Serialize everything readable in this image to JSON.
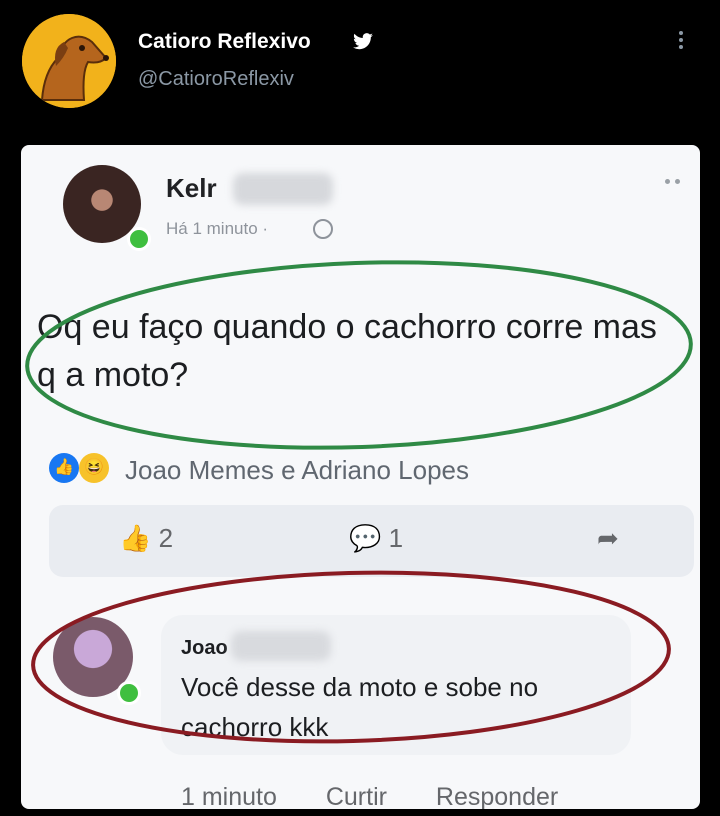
{
  "tweet": {
    "display_name": "Catioro Reflexivo",
    "handle": "@CatioroReflexiv",
    "verified_icon": "twitter-bird-icon",
    "more_icon": "vertical-dots-icon"
  },
  "post": {
    "author_name": "Kelr",
    "timestamp": "Há 1 minuto ·",
    "privacy_icon": "globe-icon",
    "text": "Oq eu faço quando o cachorro corre mas q a moto?",
    "reactions_text": "Joao Memes e Adriano Lopes",
    "like_count": "2",
    "comment_count": "1"
  },
  "comment": {
    "author_name": "Joao",
    "text": "Você desse da moto e sobe no cachorro kkk",
    "time": "1 minuto",
    "like_label": "Curtir",
    "reply_label": "Responder"
  },
  "colors": {
    "background": "#000000",
    "card": "#f7f8fa",
    "green_oval": "#2f8a45",
    "red_oval": "#8a1b22",
    "facebook_blue": "#1877f2"
  }
}
